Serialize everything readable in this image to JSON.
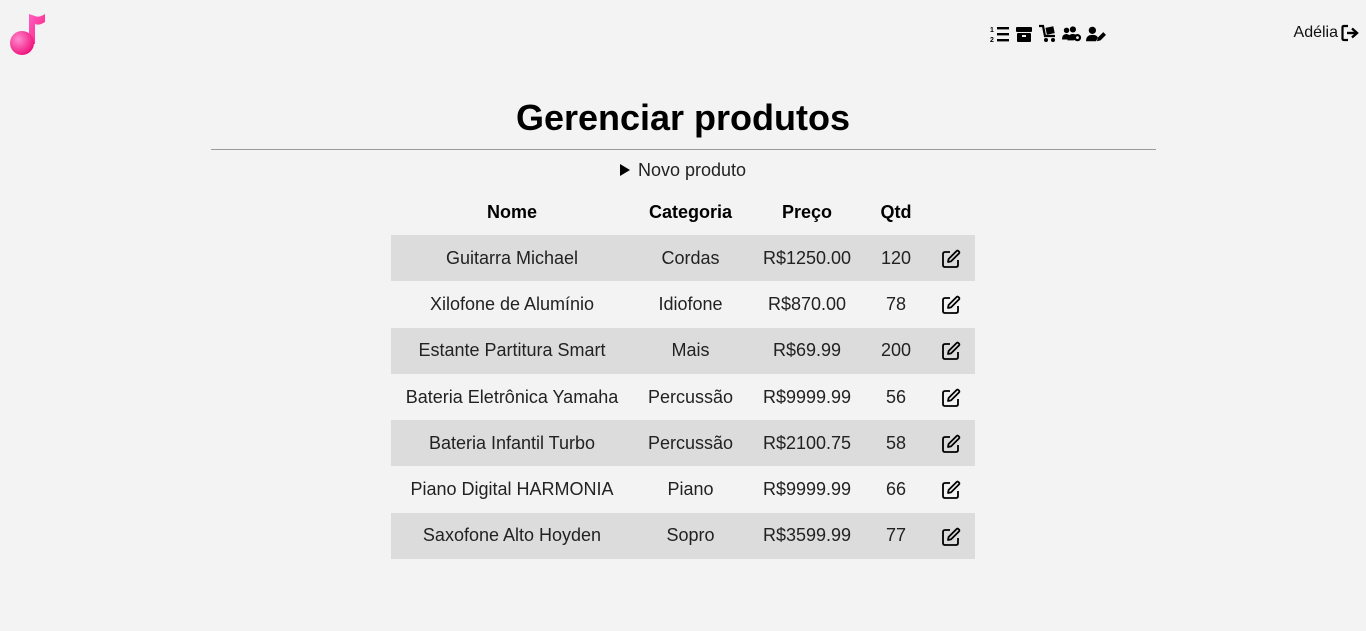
{
  "header": {
    "user_name": "Adélia",
    "nav_icons": [
      "ordered-list-icon",
      "box-icon",
      "cart-icon",
      "users-gear-icon",
      "user-edit-icon"
    ],
    "logout_icon": "sign-out-icon",
    "logo_icon": "music-note-icon",
    "logo_color": "#ff2fa0"
  },
  "main": {
    "title": "Gerenciar produtos",
    "new_product_label": "Novo produto"
  },
  "table": {
    "headers": {
      "nome": "Nome",
      "categoria": "Categoria",
      "preco": "Preço",
      "qtd": "Qtd"
    },
    "rows": [
      {
        "nome": "Guitarra Michael",
        "categoria": "Cordas",
        "preco": "R$1250.00",
        "qtd": "120"
      },
      {
        "nome": "Xilofone de Alumínio",
        "categoria": "Idiofone",
        "preco": "R$870.00",
        "qtd": "78"
      },
      {
        "nome": "Estante Partitura Smart",
        "categoria": "Mais",
        "preco": "R$69.99",
        "qtd": "200"
      },
      {
        "nome": "Bateria Eletrônica Yamaha",
        "categoria": "Percussão",
        "preco": "R$9999.99",
        "qtd": "56"
      },
      {
        "nome": "Bateria Infantil Turbo",
        "categoria": "Percussão",
        "preco": "R$2100.75",
        "qtd": "58"
      },
      {
        "nome": "Piano Digital HARMONIA",
        "categoria": "Piano",
        "preco": "R$9999.99",
        "qtd": "66"
      },
      {
        "nome": "Saxofone Alto Hoyden",
        "categoria": "Sopro",
        "preco": "R$3599.99",
        "qtd": "77"
      }
    ]
  }
}
